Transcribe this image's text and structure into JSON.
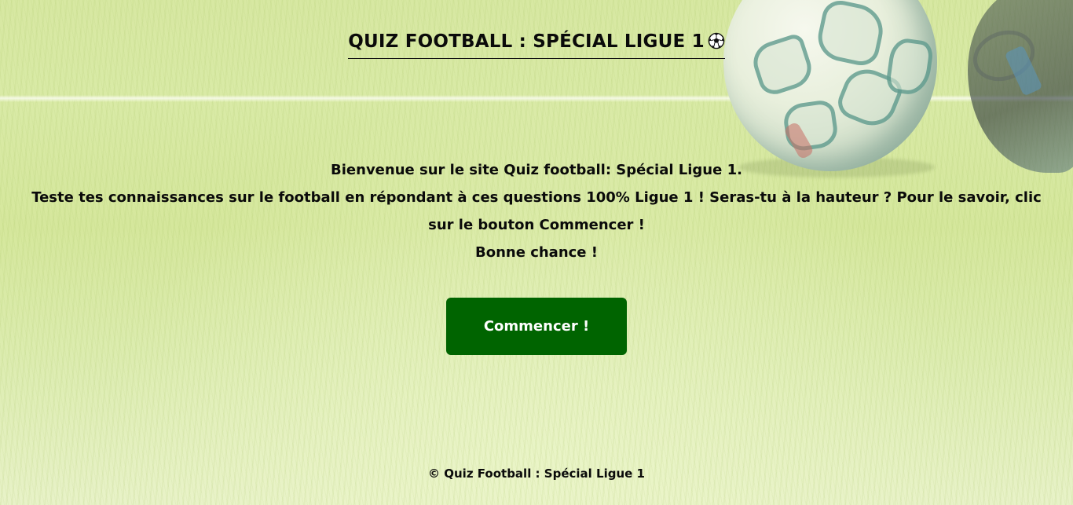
{
  "header": {
    "title": "QUIZ FOOTBALL : SPÉCIAL LIGUE 1",
    "icon": "soccer-ball-icon"
  },
  "intro": {
    "line1": "Bienvenue sur le site Quiz football: Spécial Ligue 1.",
    "line2": "Teste tes connaissances sur le football en répondant à ces questions 100% Ligue 1 ! Seras-tu à la hauteur ? Pour le savoir, clic sur le bouton Commencer !",
    "line3": "Bonne chance !"
  },
  "start_button": {
    "label": "Commencer !",
    "color": "#006400"
  },
  "footer": {
    "text": "© Quiz Football : Spécial Ligue 1"
  },
  "background": {
    "scene": "football-pitch-background",
    "tint": "#dcebb0"
  }
}
